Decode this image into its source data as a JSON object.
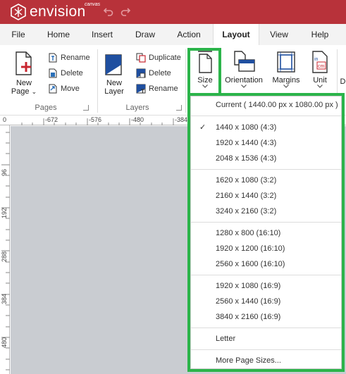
{
  "app": {
    "name": "envision",
    "sub": "canvas",
    "brand_color": "#b8323a"
  },
  "menu": {
    "tabs": [
      "File",
      "Home",
      "Insert",
      "Draw",
      "Action",
      "Layout",
      "View",
      "Help"
    ],
    "active": "Layout"
  },
  "ribbon": {
    "pages": {
      "new_page_line1": "New",
      "new_page_line2": "Page",
      "rename": "Rename",
      "delete": "Delete",
      "move": "Move",
      "label": "Pages"
    },
    "layers": {
      "new_layer_line1": "New",
      "new_layer_line2": "Layer",
      "duplicate": "Duplicate",
      "delete": "Delete",
      "rename": "Rename",
      "label": "Layers"
    },
    "layout": {
      "size": "Size",
      "orientation": "Orientation",
      "margins": "Margins",
      "unit": "Unit",
      "cut": "D"
    }
  },
  "rulers": {
    "horizontal": [
      "-672",
      "-576",
      "-480",
      "-384"
    ],
    "vertical": [
      "96",
      "192",
      "288",
      "384",
      "480"
    ],
    "origin": "0"
  },
  "size_dropdown": {
    "current": "Current ( 1440.00 px x 1080.00 px )",
    "groups": [
      [
        "1440 x 1080 (4:3)",
        "1920 x 1440 (4:3)",
        "2048 x 1536 (4:3)"
      ],
      [
        "1620 x 1080 (3:2)",
        "2160 x 1440 (3:2)",
        "3240 x 2160 (3:2)"
      ],
      [
        "1280 x 800 (16:10)",
        "1920 x 1200 (16:10)",
        "2560 x 1600 (16:10)"
      ],
      [
        "1920 x 1080 (16:9)",
        "2560 x 1440 (16:9)",
        "3840 x 2160 (16:9)"
      ],
      [
        "Letter"
      ],
      [
        "More Page Sizes..."
      ]
    ],
    "checked": "1440 x 1080 (4:3)",
    "highlight_color": "#2bb44a"
  }
}
